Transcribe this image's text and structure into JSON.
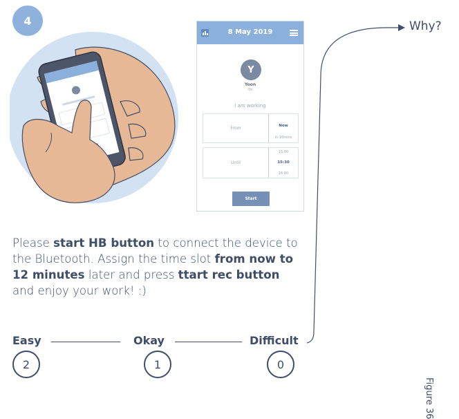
{
  "step": {
    "number": "4"
  },
  "app": {
    "date": "8 May 2019",
    "avatar_initial": "Y",
    "user_name": "Yoon",
    "user_status": "On",
    "working_label": "I am working",
    "from": {
      "label": "From",
      "selected": "Now",
      "option": "in 10mins"
    },
    "until": {
      "label": "Until",
      "options": [
        "15:00",
        "15:30",
        "16:00"
      ],
      "selected_index": 1
    },
    "start_label": "Start"
  },
  "instructions": {
    "part1": "Please ",
    "bold1": "start HB button",
    "part2": " to connect the device to the Bluetooth. Assign the time slot ",
    "bold2": "from now to 12 minutes",
    "part3": " later and press ",
    "bold3": "ttart rec button",
    "part4": " and enjoy your work! :)"
  },
  "scale": {
    "labels": [
      "Easy",
      "Okay",
      "Difficult"
    ],
    "ratings": [
      "2",
      "1",
      "0"
    ]
  },
  "why_label": "Why?",
  "side_label": "Figure 36"
}
